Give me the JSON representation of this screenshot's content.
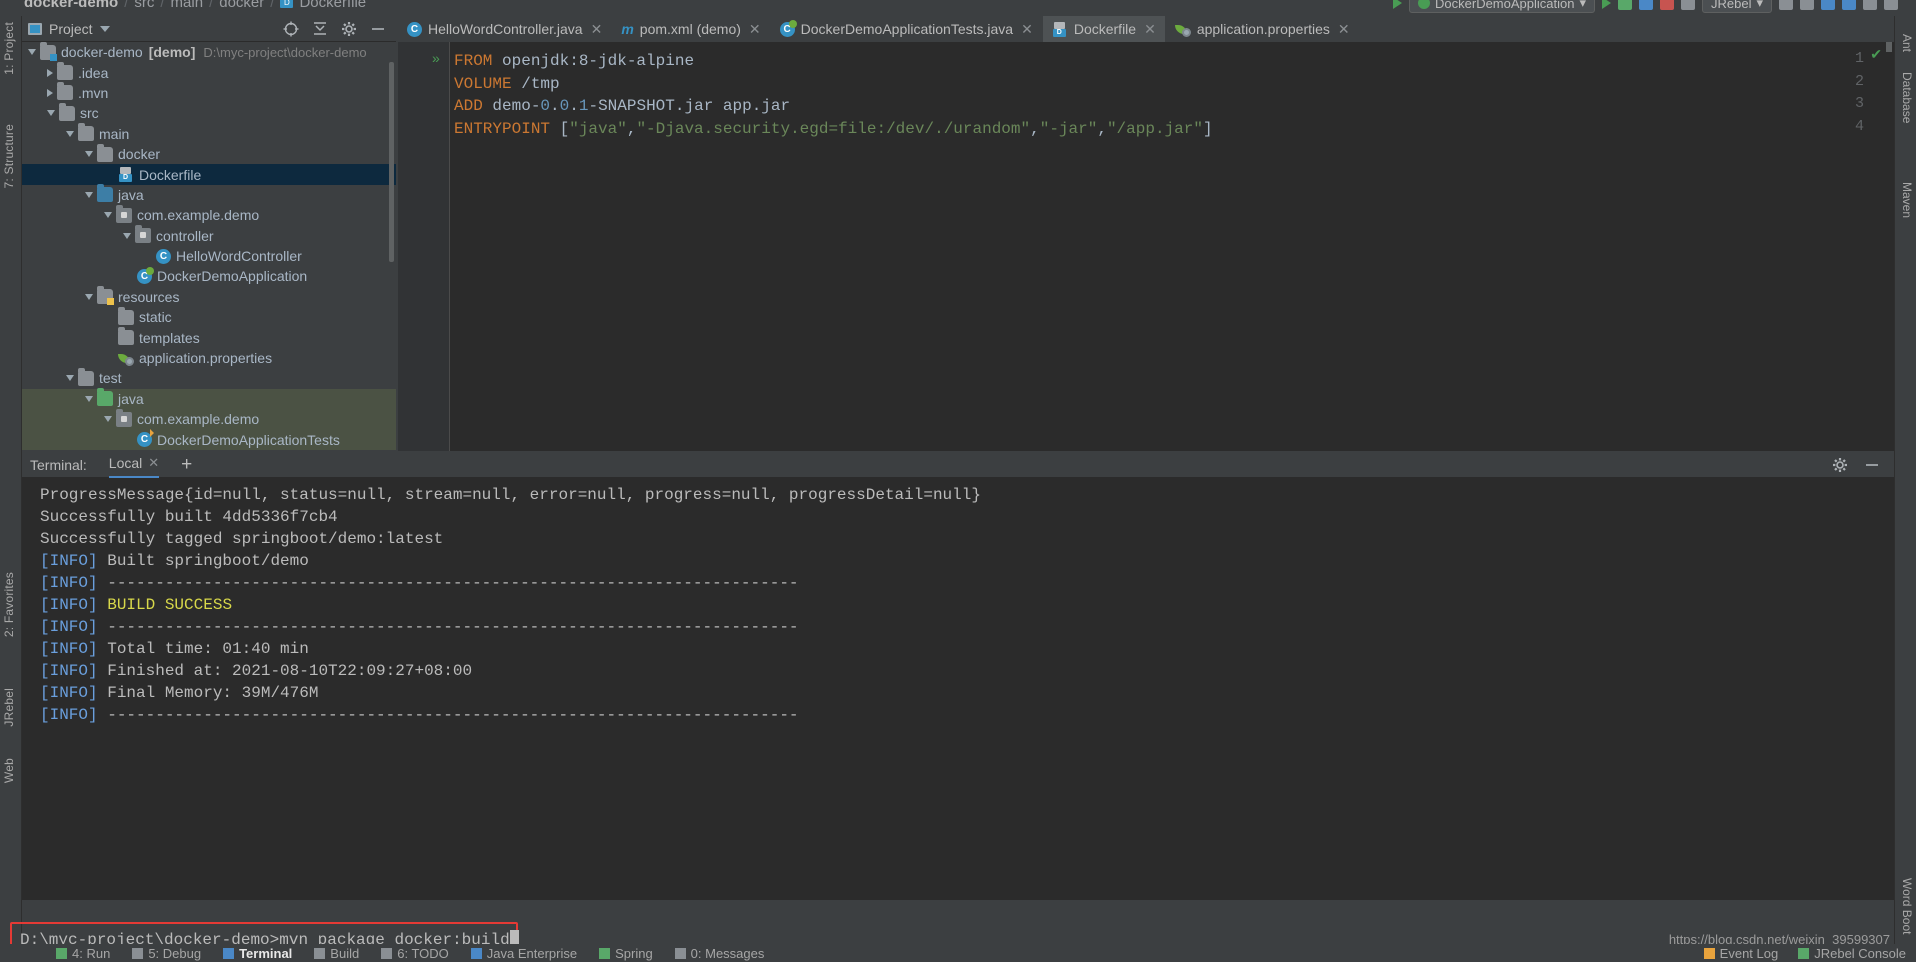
{
  "breadcrumb": {
    "items": [
      "docker-demo",
      "src",
      "main",
      "docker",
      "Dockerfile"
    ],
    "separator": "/"
  },
  "top_toolbar": {
    "run_config": "DockerDemoApplication",
    "jrebel": "JRebel",
    "dropdown_caret": "▾"
  },
  "project_panel": {
    "title": "Project",
    "icons": {
      "locate": "crosshair-icon",
      "collapse": "collapse-all-icon",
      "settings": "gear-icon",
      "hide": "minimize-icon"
    },
    "tree": [
      {
        "label": "docker-demo",
        "module": "[demo]",
        "path": "D:\\myc-project\\docker-demo",
        "depth": 0,
        "arrow": "down",
        "icon": "module-folder",
        "selected": false
      },
      {
        "label": ".idea",
        "depth": 1,
        "arrow": "right",
        "icon": "folder",
        "selected": false
      },
      {
        "label": ".mvn",
        "depth": 1,
        "arrow": "right",
        "icon": "folder",
        "selected": false
      },
      {
        "label": "src",
        "depth": 1,
        "arrow": "down",
        "icon": "folder",
        "selected": false
      },
      {
        "label": "main",
        "depth": 2,
        "arrow": "down",
        "icon": "folder",
        "selected": false
      },
      {
        "label": "docker",
        "depth": 3,
        "arrow": "down",
        "icon": "folder",
        "selected": false
      },
      {
        "label": "Dockerfile",
        "depth": 4,
        "arrow": "none",
        "icon": "dockerfile",
        "selected": true
      },
      {
        "label": "java",
        "depth": 3,
        "arrow": "down",
        "icon": "source-folder",
        "selected": false
      },
      {
        "label": "com.example.demo",
        "depth": 4,
        "arrow": "down",
        "icon": "package",
        "selected": false
      },
      {
        "label": "controller",
        "depth": 5,
        "arrow": "down",
        "icon": "package",
        "selected": false
      },
      {
        "label": "HelloWordController",
        "depth": 6,
        "arrow": "none",
        "icon": "class",
        "selected": false
      },
      {
        "label": "DockerDemoApplication",
        "depth": 5,
        "arrow": "none",
        "icon": "spring-class",
        "selected": false
      },
      {
        "label": "resources",
        "depth": 3,
        "arrow": "down",
        "icon": "resource-folder",
        "selected": false
      },
      {
        "label": "static",
        "depth": 4,
        "arrow": "none",
        "icon": "folder",
        "selected": false
      },
      {
        "label": "templates",
        "depth": 4,
        "arrow": "none",
        "icon": "folder",
        "selected": false
      },
      {
        "label": "application.properties",
        "depth": 4,
        "arrow": "none",
        "icon": "spring-properties",
        "selected": false
      },
      {
        "label": "test",
        "depth": 2,
        "arrow": "down",
        "icon": "folder",
        "selected": false
      },
      {
        "label": "java",
        "depth": 3,
        "arrow": "down",
        "icon": "test-source-folder",
        "test": true,
        "selected": false
      },
      {
        "label": "com.example.demo",
        "depth": 4,
        "arrow": "down",
        "icon": "package",
        "test": true,
        "selected": false
      },
      {
        "label": "DockerDemoApplicationTests",
        "depth": 5,
        "arrow": "none",
        "icon": "test-class",
        "test": true,
        "selected": false
      }
    ]
  },
  "editor": {
    "tabs": [
      {
        "label": "HelloWordController.java",
        "icon": "java-class-icon",
        "active": false,
        "closeable": true
      },
      {
        "label": "pom.xml (demo)",
        "icon": "maven-icon",
        "active": false,
        "closeable": true
      },
      {
        "label": "DockerDemoApplicationTests.java",
        "icon": "spring-test-class-icon",
        "active": false,
        "closeable": true
      },
      {
        "label": "Dockerfile",
        "icon": "dockerfile-icon",
        "active": true,
        "closeable": true
      },
      {
        "label": "application.properties",
        "icon": "spring-properties-icon",
        "active": false,
        "closeable": true
      }
    ],
    "filename": "Dockerfile",
    "lines": [
      {
        "n": "1",
        "runmark": true,
        "tokens": [
          {
            "t": "FROM",
            "c": "kw"
          },
          {
            "t": " openjdk:8-jdk-alpine",
            "c": "txt"
          }
        ]
      },
      {
        "n": "2",
        "runmark": false,
        "tokens": [
          {
            "t": "VOLUME",
            "c": "kw"
          },
          {
            "t": " ",
            "c": "txt"
          },
          {
            "t": "/tmp",
            "c": "txt"
          }
        ]
      },
      {
        "n": "3",
        "runmark": false,
        "tokens": [
          {
            "t": "ADD",
            "c": "kw"
          },
          {
            "t": " demo-",
            "c": "txt"
          },
          {
            "t": "0",
            "c": "num"
          },
          {
            "t": ".",
            "c": "txt"
          },
          {
            "t": "0",
            "c": "num"
          },
          {
            "t": ".",
            "c": "txt"
          },
          {
            "t": "1",
            "c": "num"
          },
          {
            "t": "-SNAPSHOT.jar app.jar",
            "c": "txt"
          }
        ]
      },
      {
        "n": "4",
        "runmark": false,
        "tokens": [
          {
            "t": "ENTRYPOINT",
            "c": "kw"
          },
          {
            "t": " [",
            "c": "txt"
          },
          {
            "t": "\"java\"",
            "c": "str"
          },
          {
            "t": ",",
            "c": "txt"
          },
          {
            "t": "\"-Djava.security.egd=file:/dev/./urandom\"",
            "c": "str"
          },
          {
            "t": ",",
            "c": "txt"
          },
          {
            "t": "\"-jar\"",
            "c": "str"
          },
          {
            "t": ",",
            "c": "txt"
          },
          {
            "t": "\"/app.jar\"",
            "c": "str"
          },
          {
            "t": "]",
            "c": "txt"
          }
        ]
      }
    ],
    "inspection_status": "✔"
  },
  "terminal": {
    "label": "Terminal:",
    "tab": "Local",
    "add_tab": "+",
    "actions": {
      "settings": "gear-icon",
      "hide": "minimize-icon"
    },
    "output": [
      {
        "text": "ProgressMessage{id=null, status=null, stream=null, error=null, progress=null, progressDetail=null}",
        "type": "plain"
      },
      {
        "text": "Successfully built 4dd5336f7cb4",
        "type": "plain"
      },
      {
        "text": "Successfully tagged springboot/demo:latest",
        "type": "plain"
      },
      {
        "prefix": "[INFO]",
        "text": " Built springboot/demo",
        "type": "info"
      },
      {
        "prefix": "[INFO]",
        "text": " ------------------------------------------------------------------------",
        "type": "info"
      },
      {
        "prefix": "[INFO]",
        "text": " ",
        "highlight": "BUILD SUCCESS",
        "type": "success"
      },
      {
        "prefix": "[INFO]",
        "text": " ------------------------------------------------------------------------",
        "type": "info"
      },
      {
        "prefix": "[INFO]",
        "text": " Total time: 01:40 min",
        "type": "info"
      },
      {
        "prefix": "[INFO]",
        "text": " Finished at: 2021-08-10T22:09:27+08:00",
        "type": "info"
      },
      {
        "prefix": "[INFO]",
        "text": " Final Memory: 39M/476M",
        "type": "info"
      },
      {
        "prefix": "[INFO]",
        "text": " ------------------------------------------------------------------------",
        "type": "info"
      }
    ],
    "prompt": "D:\\myc-project\\docker-demo>mvn package docker:build",
    "highlight_color": "#e53a35"
  },
  "watermark": "https://blog.csdn.net/weixin_39599307",
  "left_tool_tabs": [
    "1: Project",
    "7: Structure",
    "2: Favorites",
    "JRebel",
    "Web"
  ],
  "right_tool_tabs": [
    "Ant",
    "Database",
    "Maven",
    "Word Boot"
  ],
  "status_bar": {
    "items": [
      {
        "label": "4: Run",
        "icon": "run-icon",
        "active": false
      },
      {
        "label": "5: Debug",
        "icon": "debug-icon",
        "active": false
      },
      {
        "label": "Terminal",
        "icon": "terminal-icon",
        "active": true
      },
      {
        "label": "Build",
        "icon": "build-icon",
        "active": false
      },
      {
        "label": "6: TODO",
        "icon": "todo-icon",
        "active": false
      },
      {
        "label": "Java Enterprise",
        "icon": "java-enterprise-icon",
        "active": false
      },
      {
        "label": "Spring",
        "icon": "spring-icon",
        "active": false
      },
      {
        "label": "0: Messages",
        "icon": "messages-icon",
        "active": false
      }
    ],
    "right_items": [
      {
        "label": "Event Log",
        "icon": "event-log-icon"
      },
      {
        "label": "JRebel Console",
        "icon": "jrebel-icon"
      }
    ]
  }
}
